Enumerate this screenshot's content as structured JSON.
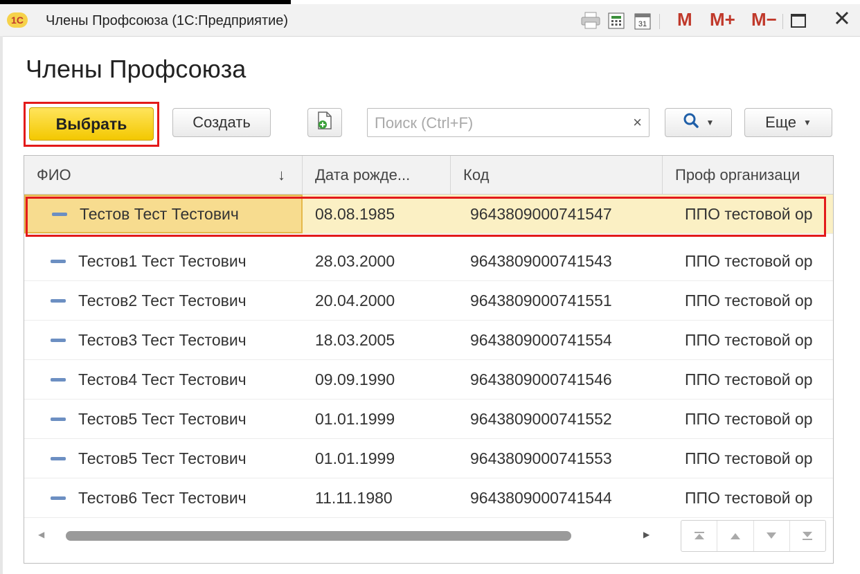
{
  "window": {
    "logo": "1С",
    "title": "Члены Профсоюза (1С:Предприятие)",
    "memory_buttons": [
      "M",
      "M+",
      "M−"
    ]
  },
  "page": {
    "heading": "Члены Профсоюза"
  },
  "toolbar": {
    "select_label": "Выбрать",
    "create_label": "Создать",
    "search_placeholder": "Поиск (Ctrl+F)",
    "search_value": "",
    "clear_symbol": "×",
    "more_label": "Еще"
  },
  "table": {
    "columns": [
      "ФИО",
      "Дата рожде...",
      "Код",
      "Проф организаци"
    ],
    "sort_indicator": "↓",
    "rows": [
      {
        "name": "Тестов Тест Тестович",
        "birth": "08.08.1985",
        "code": "9643809000741547",
        "org": "ППО тестовой ор",
        "selected": true
      },
      {
        "name": "Тестов1 Тест Тестович",
        "birth": "28.03.2000",
        "code": "9643809000741543",
        "org": "ППО тестовой ор"
      },
      {
        "name": "Тестов2 Тест Тестович",
        "birth": "20.04.2000",
        "code": "9643809000741551",
        "org": "ППО тестовой ор"
      },
      {
        "name": "Тестов3 Тест Тестович",
        "birth": "18.03.2005",
        "code": "9643809000741554",
        "org": "ППО тестовой ор"
      },
      {
        "name": "Тестов4 Тест Тестович",
        "birth": "09.09.1990",
        "code": "9643809000741546",
        "org": "ППО тестовой ор"
      },
      {
        "name": "Тестов5 Тест Тестович",
        "birth": "01.01.1999",
        "code": "9643809000741552",
        "org": "ППО тестовой ор"
      },
      {
        "name": "Тестов5 Тест Тестович",
        "birth": "01.01.1999",
        "code": "9643809000741553",
        "org": "ППО тестовой ор"
      },
      {
        "name": "Тестов6 Тест Тестович",
        "birth": "11.11.1980",
        "code": "9643809000741544",
        "org": "ППО тестовой ор"
      }
    ]
  },
  "colors": {
    "accent_yellow": "#f3c800",
    "highlight_red": "#e31a1a",
    "selected_row": "#fbf0c4"
  },
  "icons": [
    "1c-logo-icon",
    "printer-icon",
    "calculator-icon",
    "calendar-icon",
    "maximize-icon",
    "close-icon",
    "add-file-icon",
    "search-icon",
    "row-dash-icon",
    "scroll-left-icon",
    "scroll-right-icon",
    "first-icon",
    "up-icon",
    "down-icon",
    "last-icon"
  ]
}
